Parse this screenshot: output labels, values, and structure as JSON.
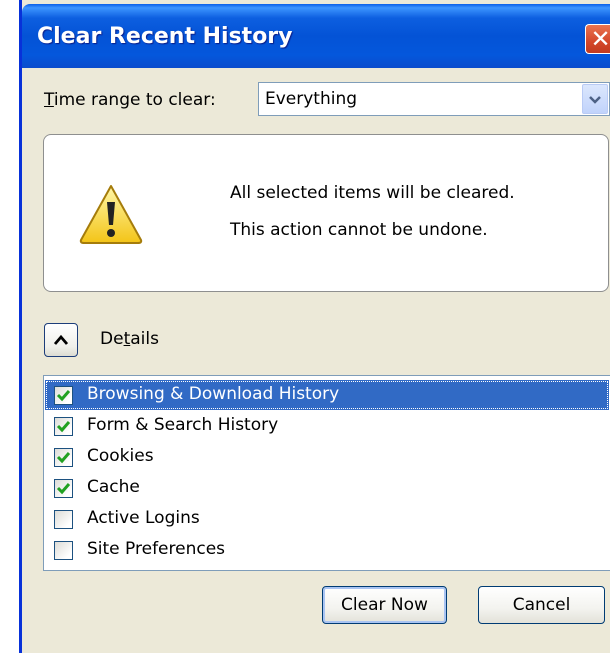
{
  "window": {
    "title": "Clear Recent History",
    "close_symbol": "✕"
  },
  "time_range": {
    "label_accel": "T",
    "label_rest": "ime range to clear:",
    "selected": "Everything"
  },
  "warning": {
    "icon": "warning-icon",
    "line1": "All selected items will be cleared.",
    "line2": "This action cannot be undone."
  },
  "details": {
    "label_pre": "De",
    "label_accel": "t",
    "label_post": "ails",
    "expanded": true
  },
  "items": [
    {
      "label": "Browsing & Download History",
      "checked": true,
      "selected": true
    },
    {
      "label": "Form & Search History",
      "checked": true,
      "selected": false
    },
    {
      "label": "Cookies",
      "checked": true,
      "selected": false
    },
    {
      "label": "Cache",
      "checked": true,
      "selected": false
    },
    {
      "label": "Active Logins",
      "checked": false,
      "selected": false
    },
    {
      "label": "Site Preferences",
      "checked": false,
      "selected": false
    }
  ],
  "buttons": {
    "clear_now": "Clear Now",
    "cancel": "Cancel"
  },
  "colors": {
    "titlebar": "#0453d6",
    "dialog_bg": "#ece9d8",
    "selection": "#316ac5",
    "checkmark": "#21a121",
    "close_button": "#d4472a"
  }
}
